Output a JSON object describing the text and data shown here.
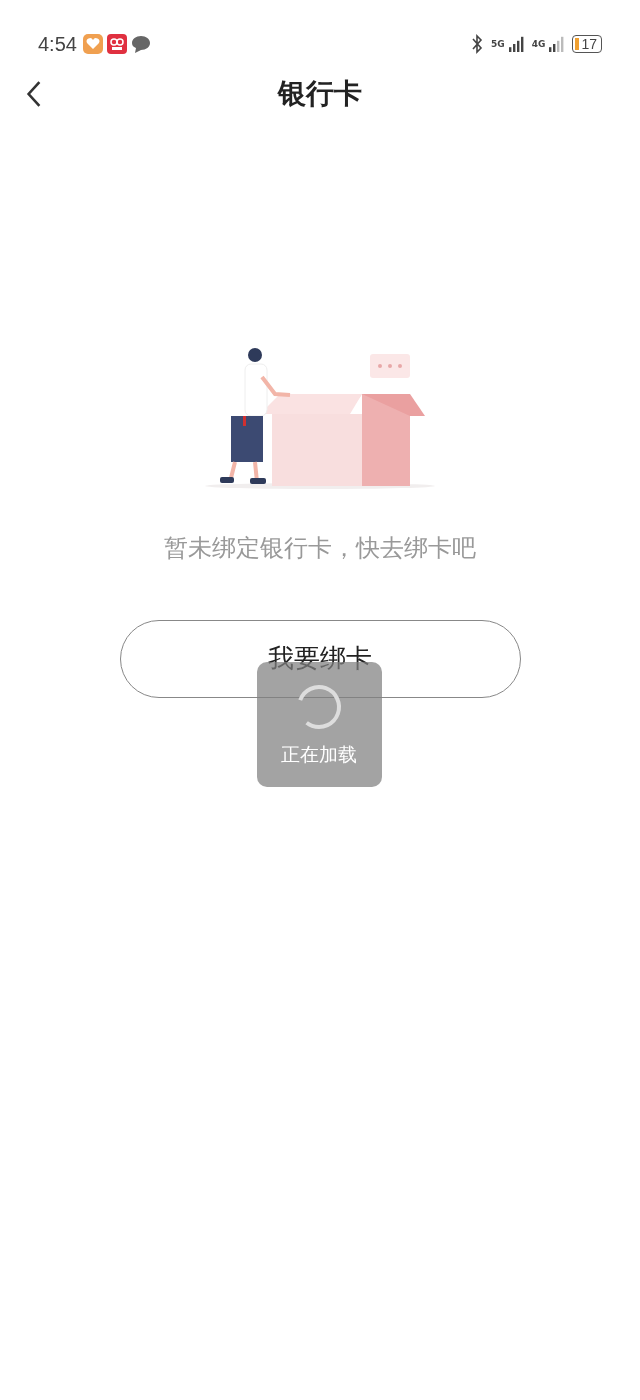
{
  "status_bar": {
    "time": "4:54",
    "network_5g": "5G",
    "network_4g": "4G",
    "battery": "17"
  },
  "header": {
    "title": "银行卡"
  },
  "empty_state": {
    "message": "暂未绑定银行卡，快去绑卡吧",
    "button": "我要绑卡"
  },
  "loading_toast": {
    "text": "正在加载"
  }
}
